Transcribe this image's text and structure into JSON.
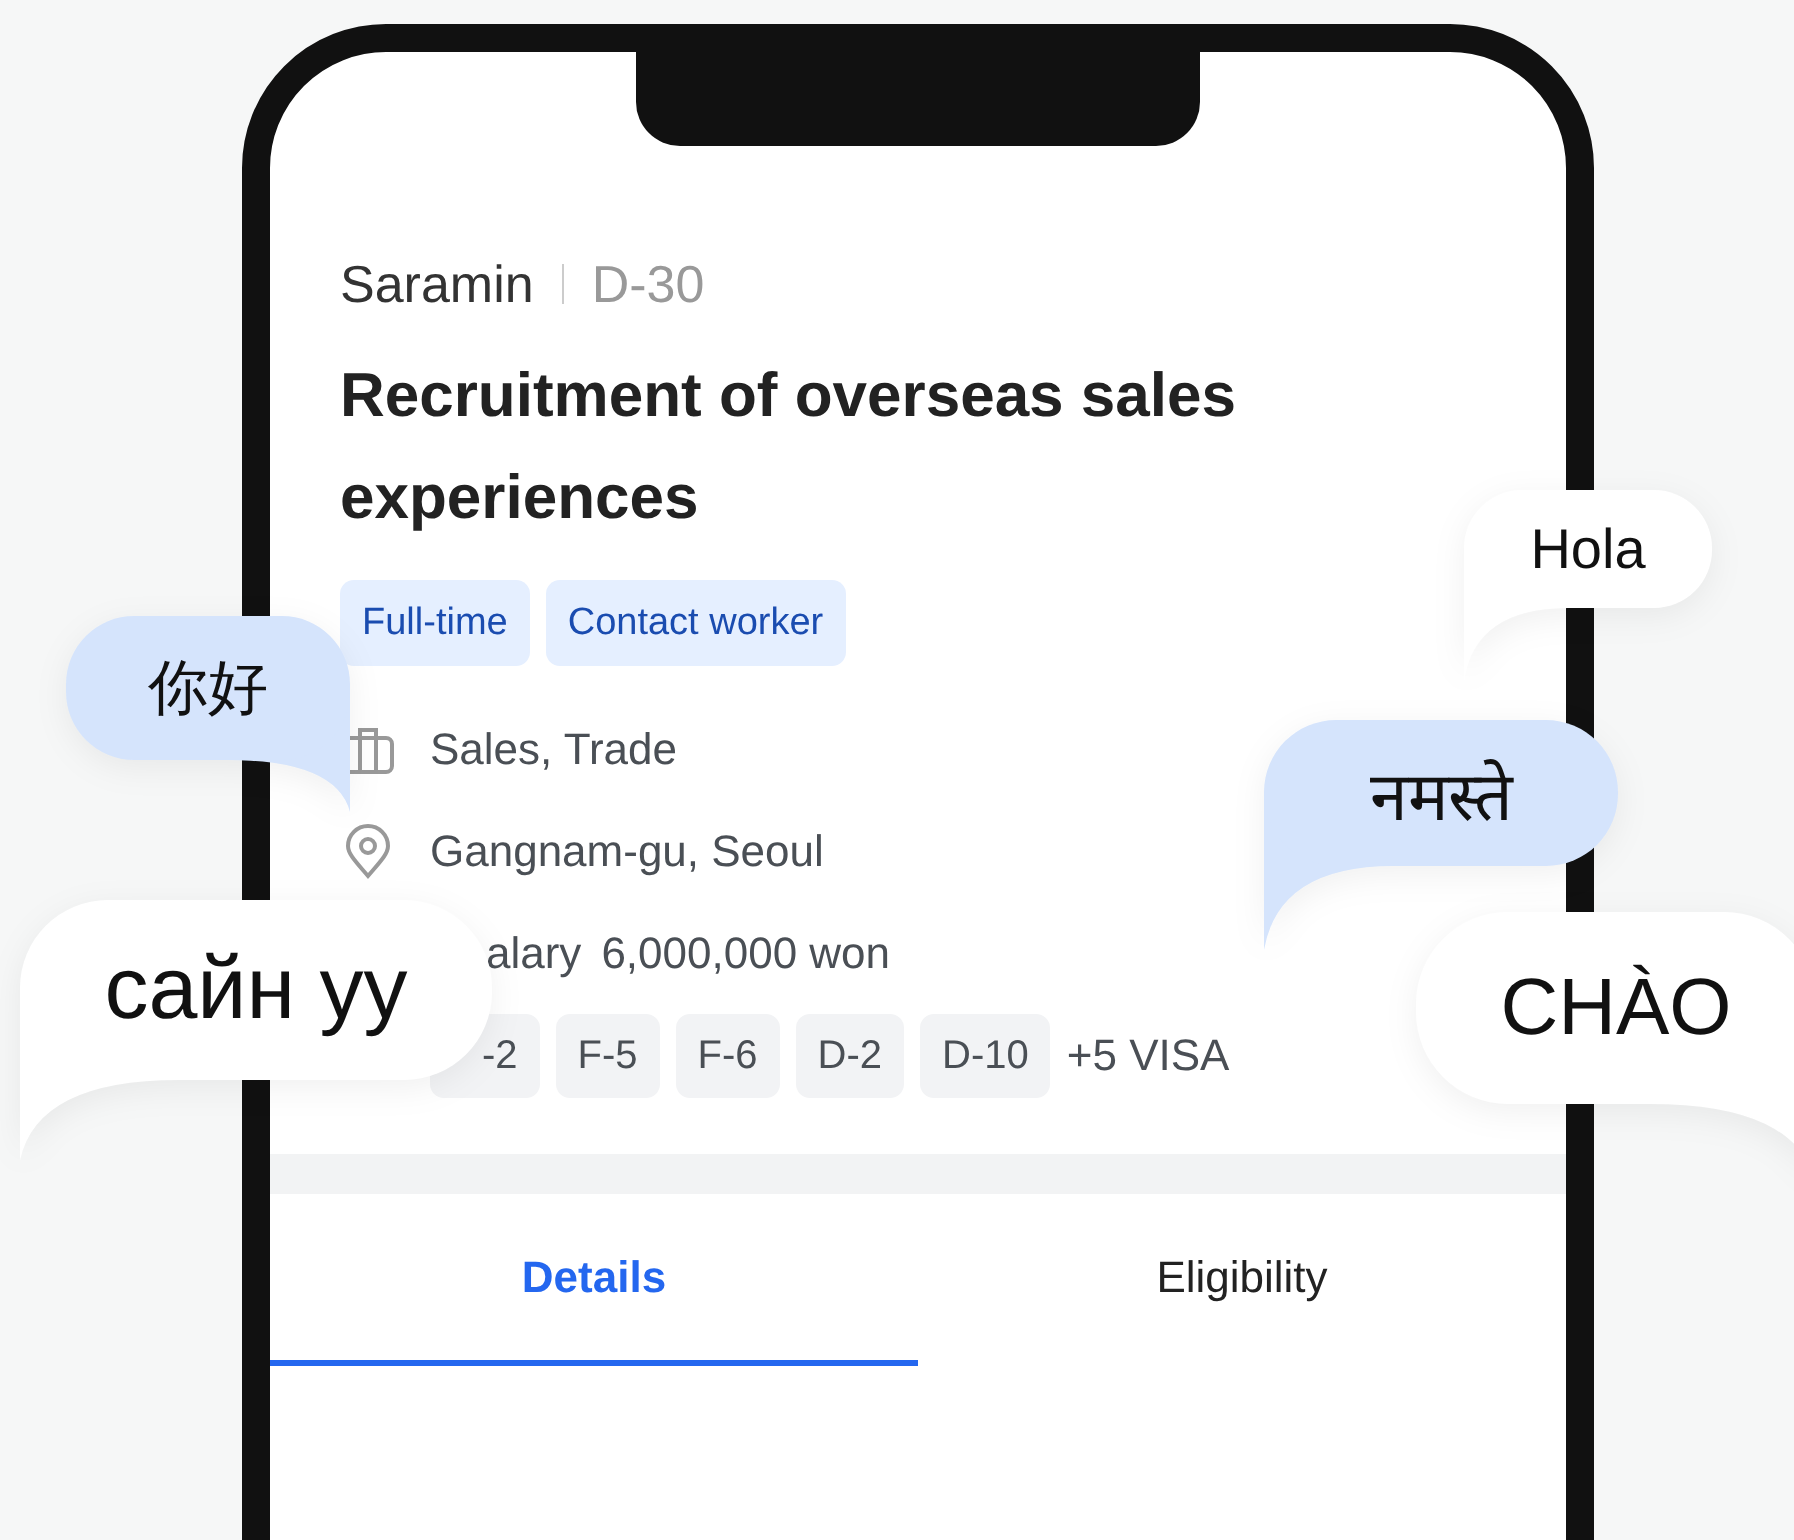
{
  "job": {
    "company": "Saramin",
    "deadline": "D-30",
    "title": "Recruitment of overseas sales experiences",
    "tags": [
      "Full-time",
      "Contact worker"
    ],
    "details": [
      {
        "kind": "category",
        "text": "Sales, Trade"
      },
      {
        "kind": "location",
        "text": "Gangnam-gu, Seoul"
      },
      {
        "kind": "salary",
        "label": "alary",
        "text": "6,000,000 won"
      }
    ],
    "visas": [
      "-2",
      "F-5",
      "F-6",
      "D-2",
      "D-10"
    ],
    "visa_more": "+5 VISA"
  },
  "tabs": [
    {
      "label": "Details",
      "selected": true
    },
    {
      "label": "Eligibility",
      "selected": false
    }
  ],
  "bubbles": [
    {
      "text": "你好",
      "color": "#d5e4fc",
      "kind": "tail-right"
    },
    {
      "text": "сайн уу",
      "color": "#ffffff",
      "kind": "tail-left"
    },
    {
      "text": "Hola",
      "color": "#ffffff",
      "kind": "tail-left"
    },
    {
      "text": "नमस्ते",
      "color": "#d5e4fc",
      "kind": "tail-left"
    },
    {
      "text": "CHÀO",
      "color": "#ffffff",
      "kind": "tail-right"
    }
  ]
}
